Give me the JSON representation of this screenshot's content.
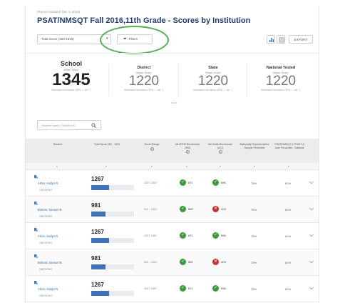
{
  "report": {
    "updated": "(Report Updated Dec 1, 2016)",
    "title": "PSAT/NMSQT Fall 2016,11th Grade - Scores by Institution"
  },
  "toolbar": {
    "score_select": "Total Score (320-1520)",
    "filters_label": "Filters",
    "export_label": "EXPORT"
  },
  "summary": {
    "school": {
      "name": "School",
      "sub": "Mean Score",
      "value": "1345",
      "sd": "Standard Deviation (SD) — ## ⓘ"
    },
    "district": {
      "name": "District",
      "sub": "Mean Score",
      "value": "1220",
      "sd": "Standard Deviation (SD) — ## ⓘ"
    },
    "state": {
      "name": "State",
      "sub": "Mean Score",
      "value": "1220",
      "sd": "Standard Deviation (SD) — ## ⓘ"
    },
    "national": {
      "name": "National Tested",
      "sub": "Mean Score",
      "value": "1220",
      "sd": "Standard Deviation (SD) — ## ⓘ"
    },
    "more_label": "Show"
  },
  "search": {
    "placeholder": "Student Name / Student ID"
  },
  "table": {
    "headers": {
      "student": "Student",
      "total": "Total Score 320 - 1520",
      "range": "Score Range",
      "erw": "Met ERW Benchmark (390)",
      "math": "Met Math Benchmark (421)",
      "natl_pct": "Nationally Representative Sample Percentile",
      "user_pct": "PSAT/NMSQT & PSAT 10 User Percentile - National"
    },
    "rows": [
      {
        "name": "Arbor, Katlyn R.",
        "id": "1581782947",
        "total": "1267",
        "fill": 0.42,
        "range": "1227-1307",
        "erw": "671",
        "erw_ok": true,
        "math": "596",
        "math_ok": true,
        "natl": "75%",
        "user": "81%"
      },
      {
        "name": "Bolmar, Samuel B.",
        "id": "1581782947",
        "total": "981",
        "fill": 0.34,
        "range": "941 - 1021",
        "erw": "552",
        "erw_ok": true,
        "math": "429",
        "math_ok": false,
        "natl": "75%",
        "user": "81%"
      },
      {
        "name": "Arbor, Katlyn R.",
        "id": "1581782947",
        "total": "1267",
        "fill": 0.42,
        "range": "1227-1307",
        "erw": "671",
        "erw_ok": true,
        "math": "596",
        "math_ok": true,
        "natl": "75%",
        "user": "81%"
      },
      {
        "name": "Bolmar, Samuel B.",
        "id": "1581782947",
        "total": "981",
        "fill": 0.34,
        "range": "941 - 1021",
        "erw": "552",
        "erw_ok": true,
        "math": "429",
        "math_ok": false,
        "natl": "75%",
        "user": "81%"
      },
      {
        "name": "Arbor, Katlyn R.",
        "id": "1581782947",
        "total": "1267",
        "fill": 0.42,
        "range": "1227-1307",
        "erw": "671",
        "erw_ok": true,
        "math": "596",
        "math_ok": true,
        "natl": "75%",
        "user": "81%"
      }
    ]
  },
  "colors": {
    "title": "#1f3e73",
    "bar": "#3f72b8",
    "met": "#3d9a3d",
    "not_met": "#c43131",
    "highlight": "#4cae4f"
  }
}
